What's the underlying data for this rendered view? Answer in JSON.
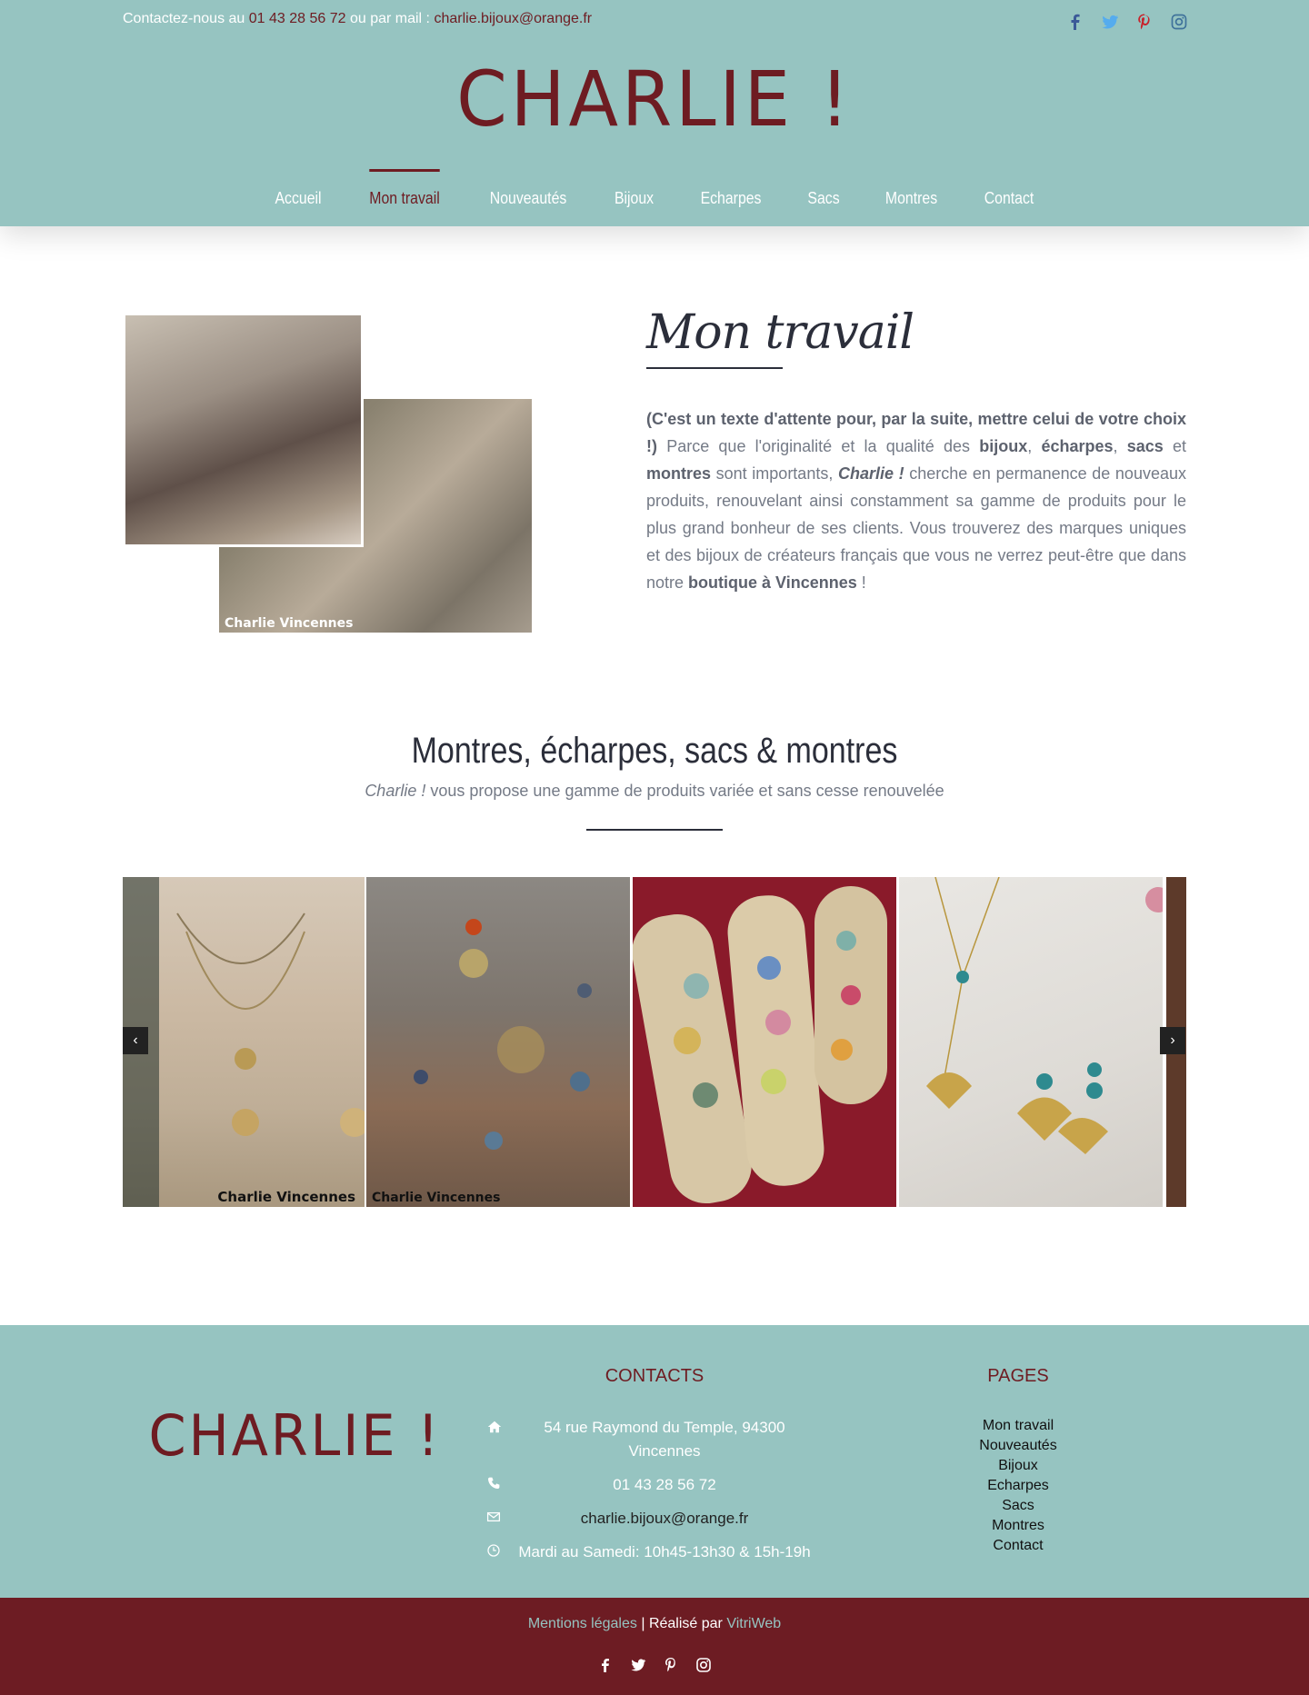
{
  "topbar": {
    "prefix": "Contactez-nous au ",
    "phone": "01 43 28 56 72",
    "middle": " ou par mail : ",
    "email": "charlie.bijoux@orange.fr"
  },
  "social_icons": [
    "facebook-icon",
    "twitter-icon",
    "pinterest-icon",
    "instagram-icon"
  ],
  "brand": {
    "logo": "CHARLIE !"
  },
  "nav": {
    "items": [
      "Accueil",
      "Mon travail",
      "Nouveautés",
      "Bijoux",
      "Echarpes",
      "Sacs",
      "Montres",
      "Contact"
    ],
    "active": "Mon travail"
  },
  "intro": {
    "watermark": "Charlie Vincennes",
    "title": "Mon travail",
    "p1_bold": "(C'est un texte d'attente pour, par la suite, mettre celui de votre choix !)",
    "p2_start": " Parce que l'originalité et la qualité des ",
    "kw1": "bijoux",
    "sep1": ", ",
    "kw2": "écharpes",
    "sep2": ", ",
    "kw3": "sacs",
    "sep3": " et ",
    "kw4": "montres",
    "p2_mid": " sont importants, ",
    "brand_em": "Charlie !",
    "p2_end": " cherche en permanence de nouveaux produits, renouvelant ainsi constamment sa gamme de produits pour le plus grand bonheur de ses clients. Vous trouverez des marques uniques et des bijoux de créateurs français que vous ne verrez peut-être que dans notre ",
    "shop": "boutique à Vincennes",
    "p2_close": " !"
  },
  "section": {
    "title": "Montres, écharpes, sacs & montres",
    "subtitle_em": "Charlie !",
    "subtitle_rest": " vous propose une gamme de produits variée et sans cesse renouvelée"
  },
  "carousel": {
    "watermark_1": "Charlie Vincennes",
    "watermark_2": "Charlie Vincennes",
    "prev": "‹",
    "next": "›"
  },
  "footer": {
    "logo": "CHARLIE !",
    "contacts_heading": "CONTACTS",
    "address": "54 rue Raymond du Temple, 94300 Vincennes",
    "phone": "01 43 28 56 72",
    "email": "charlie.bijoux@orange.fr",
    "hours": "Mardi au Samedi: 10h45-13h30 & 15h-19h",
    "pages_heading": "PAGES",
    "pages": [
      "Mon travail",
      "Nouveautés",
      "Bijoux",
      "Echarpes",
      "Sacs",
      "Montres",
      "Contact"
    ]
  },
  "bottom": {
    "legal": "Mentions légales",
    "sep": " | ",
    "made_by": "Réalisé par ",
    "agency": "VitriWeb"
  },
  "colors": {
    "teal": "#96c4c1",
    "burgundy": "#6e1c22",
    "dark_text": "#2b2e3a",
    "body_text": "#747a86"
  }
}
